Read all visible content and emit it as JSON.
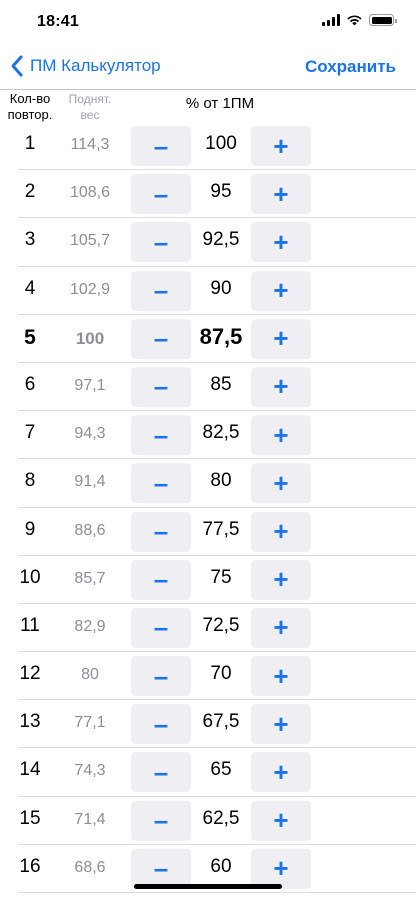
{
  "status": {
    "time": "18:41",
    "icons": [
      "signal-icon",
      "wifi-icon",
      "battery-icon"
    ]
  },
  "nav": {
    "back_label": "ПМ Калькулятор",
    "save_label": "Сохранить"
  },
  "columns": {
    "reps_line1": "Кол-во",
    "reps_line2": "повтор.",
    "weight_line1": "Поднят.",
    "weight_line2": "вес",
    "percent": "% от 1ПМ"
  },
  "steppers": {
    "minus": "–",
    "plus": "+"
  },
  "rows": [
    {
      "reps": "1",
      "weight": "114,3",
      "percent": "100"
    },
    {
      "reps": "2",
      "weight": "108,6",
      "percent": "95"
    },
    {
      "reps": "3",
      "weight": "105,7",
      "percent": "92,5"
    },
    {
      "reps": "4",
      "weight": "102,9",
      "percent": "90"
    },
    {
      "reps": "5",
      "weight": "100",
      "percent": "87,5",
      "selected": true
    },
    {
      "reps": "6",
      "weight": "97,1",
      "percent": "85"
    },
    {
      "reps": "7",
      "weight": "94,3",
      "percent": "82,5"
    },
    {
      "reps": "8",
      "weight": "91,4",
      "percent": "80"
    },
    {
      "reps": "9",
      "weight": "88,6",
      "percent": "77,5"
    },
    {
      "reps": "10",
      "weight": "85,7",
      "percent": "75"
    },
    {
      "reps": "11",
      "weight": "82,9",
      "percent": "72,5"
    },
    {
      "reps": "12",
      "weight": "80",
      "percent": "70"
    },
    {
      "reps": "13",
      "weight": "77,1",
      "percent": "67,5"
    },
    {
      "reps": "14",
      "weight": "74,3",
      "percent": "65"
    },
    {
      "reps": "15",
      "weight": "71,4",
      "percent": "62,5"
    },
    {
      "reps": "16",
      "weight": "68,6",
      "percent": "60"
    }
  ],
  "colors": {
    "accent": "#1a74e8",
    "secondary_text": "#8e8e93",
    "stepper_bg": "#eeeef3",
    "separator": "#dcdce0"
  }
}
